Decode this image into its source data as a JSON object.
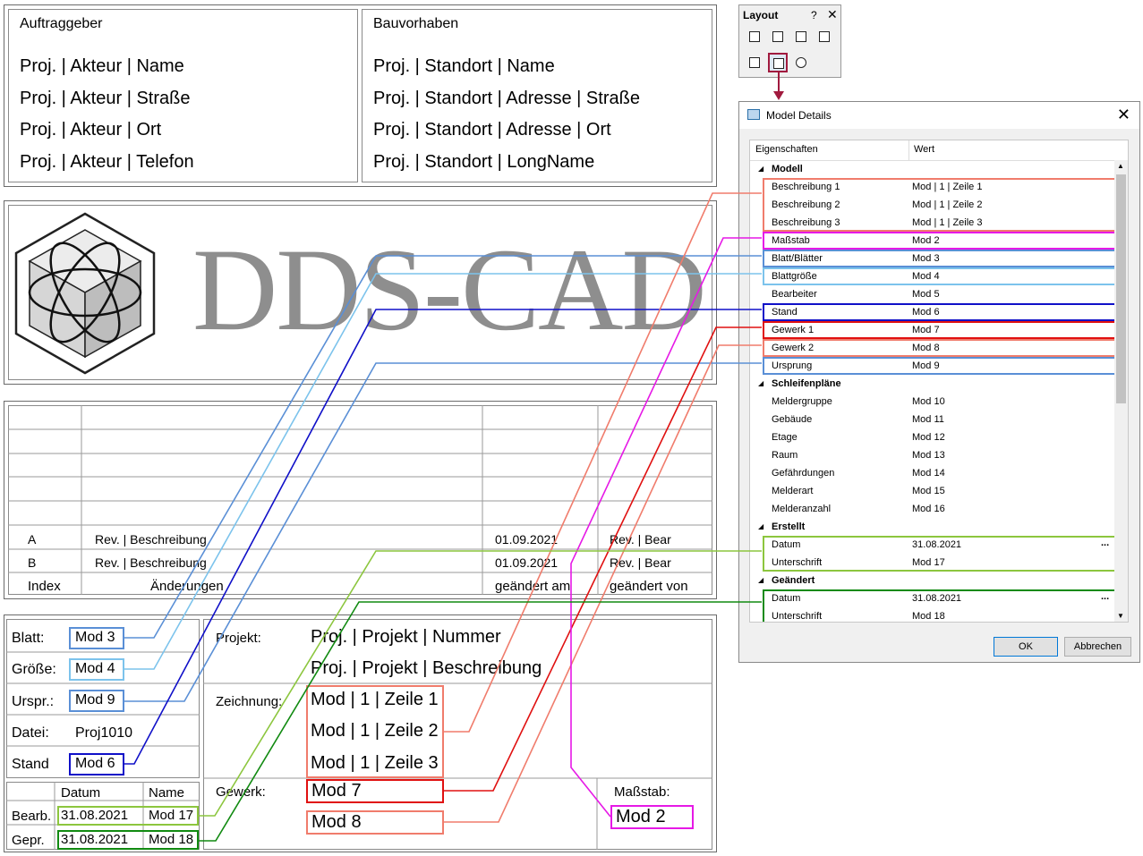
{
  "top_left": {
    "title": "Auftraggeber",
    "lines": [
      "Proj. | Akteur | Name",
      "Proj. | Akteur | Straße",
      "Proj. | Akteur | Ort",
      "Proj. | Akteur | Telefon"
    ]
  },
  "top_right": {
    "title": "Bauvorhaben",
    "lines": [
      "Proj. | Standort | Name",
      "Proj. | Standort | Adresse | Straße",
      "Proj. | Standort | Adresse | Ort",
      "Proj. | Standort | LongName"
    ]
  },
  "logo": {
    "text": "DDS-CAD"
  },
  "revision": {
    "rows": [
      {
        "index": "A",
        "desc": "Rev. | Beschreibung",
        "date": "01.09.2021",
        "by": "Rev. | Bear"
      },
      {
        "index": "B",
        "desc": "Rev. | Beschreibung",
        "date": "01.09.2021",
        "by": "Rev. | Bear"
      }
    ],
    "header": {
      "index": "Index",
      "desc": "Änderungen",
      "date": "geändert am",
      "by": "geändert von"
    }
  },
  "titleblock": {
    "blatt_label": "Blatt:",
    "blatt_value": "Mod 3",
    "groesse_label": "Größe:",
    "groesse_value": "Mod 4",
    "urspr_label": "Urspr.:",
    "urspr_value": "Mod 9",
    "datei_label": "Datei:",
    "datei_value": "Proj1010",
    "stand_label": "Stand",
    "stand_value": "Mod 6",
    "datum_header": "Datum",
    "name_header": "Name",
    "bearb_label": "Bearb.",
    "bearb_date": "31.08.2021",
    "bearb_name": "Mod 17",
    "gepr_label": "Gepr.",
    "gepr_date": "31.08.2021",
    "gepr_name": "Mod 18",
    "projekt_label": "Projekt:",
    "projekt_line1": "Proj. | Projekt | Nummer",
    "projekt_line2": "Proj. | Projekt | Beschreibung",
    "zeichnung_label": "Zeichnung:",
    "zeile1": "Mod | 1 | Zeile 1",
    "zeile2": "Mod | 1 | Zeile 2",
    "zeile3": "Mod | 1 | Zeile 3",
    "gewerk_label": "Gewerk:",
    "gewerk1": "Mod 7",
    "gewerk2": "Mod 8",
    "massstab_label": "Maßstab:",
    "massstab_value": "Mod 2"
  },
  "layout_toolbar": {
    "title": "Layout",
    "help": "?",
    "close": "✕"
  },
  "dialog": {
    "title": "Model Details",
    "col_props": "Eigenschaften",
    "col_value": "Wert",
    "ok": "OK",
    "cancel": "Abbrechen",
    "rows": [
      {
        "k": "Modell",
        "v": "",
        "cat": true
      },
      {
        "k": "Beschreibung 1",
        "v": "Mod | 1 | Zeile 1"
      },
      {
        "k": "Beschreibung 2",
        "v": "Mod | 1 | Zeile 2"
      },
      {
        "k": "Beschreibung 3",
        "v": "Mod | 1 | Zeile 3"
      },
      {
        "k": "Maßstab",
        "v": "Mod 2"
      },
      {
        "k": "Blatt/Blätter",
        "v": "Mod 3"
      },
      {
        "k": "Blattgröße",
        "v": "Mod 4"
      },
      {
        "k": "Bearbeiter",
        "v": "Mod 5"
      },
      {
        "k": "Stand",
        "v": "Mod 6"
      },
      {
        "k": "Gewerk 1",
        "v": "Mod 7"
      },
      {
        "k": "Gewerk 2",
        "v": "Mod 8"
      },
      {
        "k": "Ursprung",
        "v": "Mod 9"
      },
      {
        "k": "Schleifenpläne",
        "v": "",
        "cat": true
      },
      {
        "k": "Meldergruppe",
        "v": "Mod 10"
      },
      {
        "k": "Gebäude",
        "v": "Mod 11"
      },
      {
        "k": "Etage",
        "v": "Mod 12"
      },
      {
        "k": "Raum",
        "v": "Mod 13"
      },
      {
        "k": "Gefährdungen",
        "v": "Mod 14"
      },
      {
        "k": "Melderart",
        "v": "Mod 15"
      },
      {
        "k": "Melderanzahl",
        "v": "Mod 16"
      },
      {
        "k": "Erstellt",
        "v": "",
        "cat": true
      },
      {
        "k": "Datum",
        "v": "31.08.2021"
      },
      {
        "k": "Unterschrift",
        "v": "Mod 17"
      },
      {
        "k": "Geändert",
        "v": "",
        "cat": true
      },
      {
        "k": "Datum",
        "v": "31.08.2021"
      },
      {
        "k": "Unterschrift",
        "v": "Mod 18"
      }
    ],
    "ellipsis": "..."
  },
  "colors": {
    "salmon": "#f07c6c",
    "magenta": "#e619e6",
    "steel": "#5a8fd6",
    "sky": "#7cc3ec",
    "navy": "#1010c8",
    "red": "#e01010",
    "lime": "#8cc63e",
    "green": "#118a11"
  }
}
